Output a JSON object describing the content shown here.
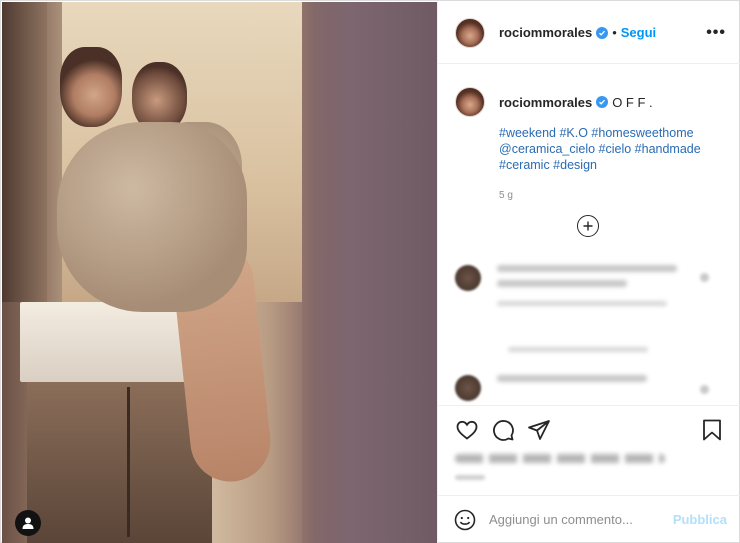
{
  "post": {
    "username": "rociommorales",
    "follow_label": "Segui",
    "separator": "•",
    "more_label": "•••"
  },
  "caption": {
    "username": "rociommorales",
    "text": "O F F .",
    "hashtags": "#weekend #K.O #homesweethome @ceramica_cielo #cielo #handmade #ceramic #design",
    "time": "5 g"
  },
  "comment_box": {
    "placeholder": "Aggiungi un commento...",
    "publish_label": "Pubblica"
  },
  "icons": {
    "verified": "verified-badge-icon",
    "like": "heart-icon",
    "comment": "comment-icon",
    "share": "share-icon",
    "save": "bookmark-icon",
    "emoji": "emoji-icon",
    "load_more": "plus-circle-icon",
    "user_tag": "user-icon"
  },
  "colors": {
    "accent": "#0095f6",
    "publish_disabled": "#b2dffc",
    "hashtag": "#2a6bb3"
  }
}
